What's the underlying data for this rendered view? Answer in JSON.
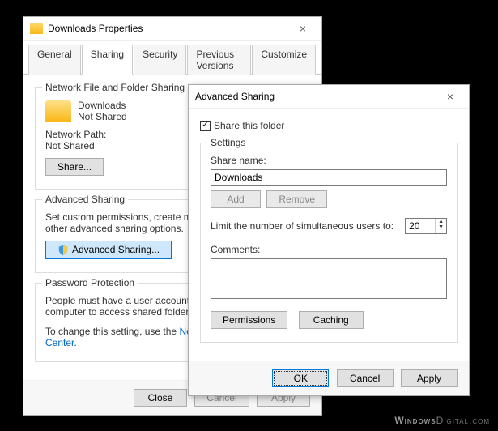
{
  "propertiesWindow": {
    "title": "Downloads Properties",
    "tabs": [
      "General",
      "Sharing",
      "Security",
      "Previous Versions",
      "Customize"
    ],
    "activeTab": "Sharing",
    "networkSharing": {
      "legend": "Network File and Folder Sharing",
      "itemName": "Downloads",
      "itemStatus": "Not Shared",
      "pathLabel": "Network Path:",
      "pathValue": "Not Shared",
      "shareButton": "Share..."
    },
    "advancedSharing": {
      "legend": "Advanced Sharing",
      "description": "Set custom permissions, create multiple shares, and set other advanced sharing options.",
      "button": "Advanced Sharing..."
    },
    "passwordProtection": {
      "legend": "Password Protection",
      "line1": "People must have a user account and password for this computer to access shared folders.",
      "line2Prefix": "To change this setting, use the ",
      "linkText": "Network and Sharing Center"
    },
    "footer": {
      "close": "Close",
      "cancel": "Cancel",
      "apply": "Apply"
    }
  },
  "advancedDialog": {
    "title": "Advanced Sharing",
    "shareCheckboxLabel": "Share this folder",
    "shareChecked": true,
    "settingsLegend": "Settings",
    "shareNameLabel": "Share name:",
    "shareNameValue": "Downloads",
    "addButton": "Add",
    "removeButton": "Remove",
    "limitLabel": "Limit the number of simultaneous users to:",
    "limitValue": "20",
    "commentsLabel": "Comments:",
    "commentsValue": "",
    "permissionsButton": "Permissions",
    "cachingButton": "Caching",
    "footer": {
      "ok": "OK",
      "cancel": "Cancel",
      "apply": "Apply"
    }
  },
  "watermark": {
    "a": "Windows",
    "b": "Digital.com"
  }
}
